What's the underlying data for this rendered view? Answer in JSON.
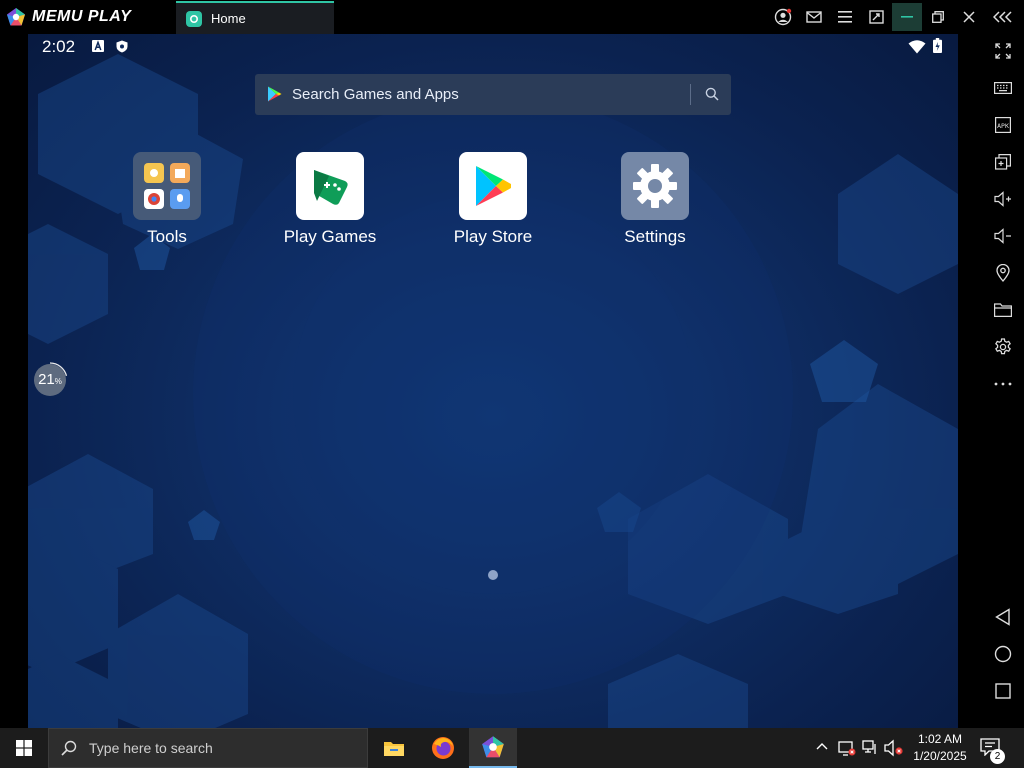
{
  "titlebar": {
    "app_name": "MEMU PLAY",
    "tab_home_label": "Home",
    "accent_color": "#2fc5a5"
  },
  "status_bar": {
    "time": "2:02",
    "icons": [
      "a-notification-icon",
      "shield-notification-icon",
      "wifi-icon",
      "battery-icon"
    ]
  },
  "search": {
    "placeholder": "Search Games and Apps"
  },
  "apps": [
    {
      "label": "Tools",
      "icon": "tools-folder-icon"
    },
    {
      "label": "Play Games",
      "icon": "play-games-icon"
    },
    {
      "label": "Play Store",
      "icon": "play-store-icon"
    },
    {
      "label": "Settings",
      "icon": "settings-gear-icon"
    }
  ],
  "progress": {
    "value": "21",
    "unit": "%",
    "fraction": 0.21
  },
  "sidebar_tools": [
    "fullscreen-icon",
    "keyboard-icon",
    "apk-icon",
    "multi-window-icon",
    "volume-up-icon",
    "volume-down-icon",
    "location-icon",
    "folder-icon",
    "settings-icon",
    "more-icon",
    "back-icon",
    "home-icon",
    "recents-icon"
  ],
  "taskbar": {
    "search_placeholder": "Type here to search",
    "time": "1:02 AM",
    "date": "1/20/2025",
    "notification_count": "2"
  }
}
